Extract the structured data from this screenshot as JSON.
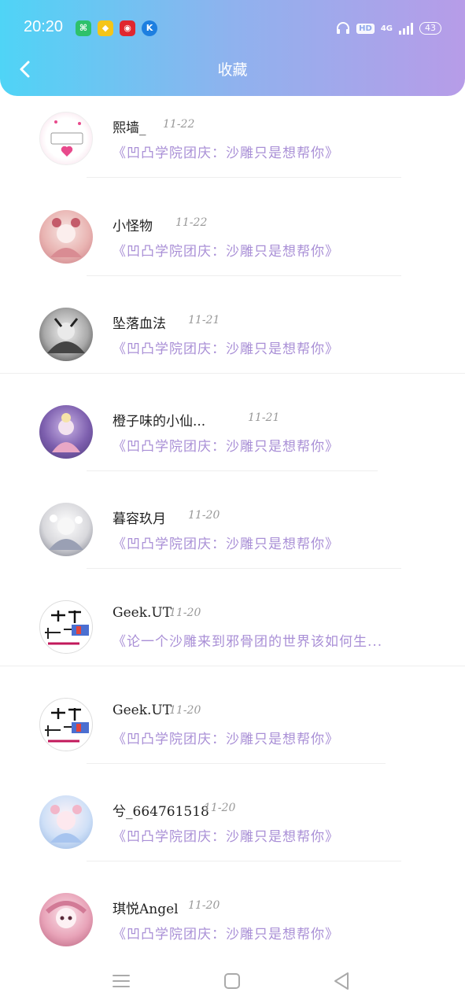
{
  "status_bar": {
    "time": "20:20",
    "network": "4G",
    "battery": "43",
    "hd": "HD"
  },
  "header": {
    "title": "收藏"
  },
  "items": [
    {
      "name": "熙墙_",
      "date": "11-22",
      "subtitle": "《凹凸学院团庆：沙雕只是想帮你》"
    },
    {
      "name": "小怪物",
      "date": "11-22",
      "subtitle": "《凹凸学院团庆：沙雕只是想帮你》"
    },
    {
      "name": "坠落血法",
      "date": "11-21",
      "subtitle": "《凹凸学院团庆：沙雕只是想帮你》"
    },
    {
      "name": "橙子味的小仙...",
      "date": "11-21",
      "subtitle": "《凹凸学院团庆：沙雕只是想帮你》"
    },
    {
      "name": "暮容玖月",
      "date": "11-20",
      "subtitle": "《凹凸学院团庆：沙雕只是想帮你》"
    },
    {
      "name": "Geek.UT",
      "date": "11-20",
      "subtitle": "《论一个沙雕来到邪骨团的世界该如何生..."
    },
    {
      "name": "Geek.UT",
      "date": "11-20",
      "subtitle": "《凹凸学院团庆：沙雕只是想帮你》"
    },
    {
      "name": "兮_664761518",
      "date": "11-20",
      "subtitle": "《凹凸学院团庆：沙雕只是想帮你》"
    },
    {
      "name": "琪悦Angel",
      "date": "11-20",
      "subtitle": "《凹凸学院团庆：沙雕只是想帮你》"
    }
  ],
  "colors": {
    "gradient_start": "#4fd4f6",
    "gradient_end": "#b79ce8",
    "subtitle": "#a98fd6"
  }
}
